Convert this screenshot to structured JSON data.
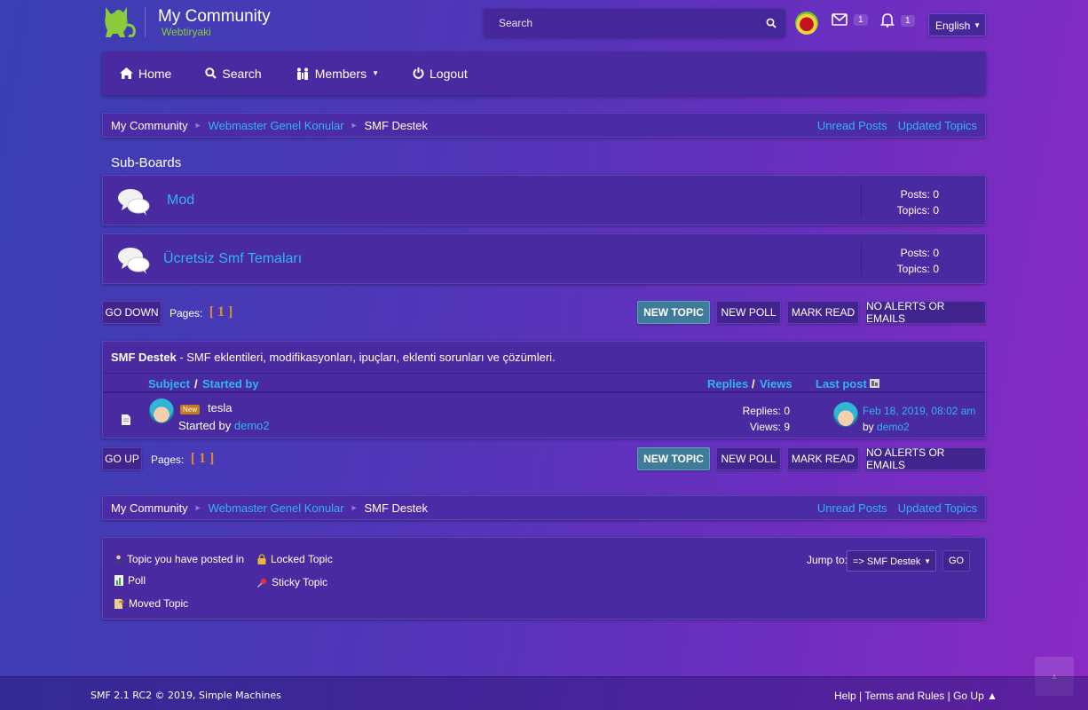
{
  "site": {
    "title": "My Community",
    "subtitle": "Webtiryaki"
  },
  "search": {
    "placeholder": "Search"
  },
  "user": {
    "messages_count": "1",
    "alerts_count": "1",
    "language": "English"
  },
  "nav": {
    "home": "Home",
    "search": "Search",
    "members": "Members",
    "logout": "Logout"
  },
  "breadcrumb": {
    "items": [
      "My Community",
      "Webmaster Genel Konular",
      "SMF Destek"
    ],
    "unread": "Unread Posts",
    "updated": "Updated Topics"
  },
  "subboards": {
    "title": "Sub-Boards",
    "boards": [
      {
        "name": "Mod",
        "posts": "Posts: 0",
        "topics": "Topics: 0"
      },
      {
        "name": "Ücretsiz Smf Temaları",
        "posts": "Posts: 0",
        "topics": "Topics: 0"
      }
    ]
  },
  "actions": {
    "go_down": "GO DOWN",
    "go_up": "GO UP",
    "pages_label": "Pages:",
    "page_num": "[ 1 ]",
    "new_topic": "NEW TOPIC",
    "new_poll": "NEW POLL",
    "mark_read": "MARK READ",
    "no_alerts": "NO ALERTS OR EMAILS"
  },
  "board": {
    "name": "SMF Destek",
    "description": " - SMF eklentileri, modifikasyonları, ipuçları, eklenti sorunları ve çözümleri."
  },
  "columns": {
    "subject": "Subject",
    "slash": "/",
    "started_by": "Started by",
    "replies": "Replies",
    "views": "Views",
    "last_post": "Last post"
  },
  "topics": [
    {
      "badge": "New",
      "title": "tesla",
      "started_prefix": "Started by ",
      "author": "demo2",
      "replies": "Replies: 0",
      "views": "Views: 9",
      "last_date": "Feb 18, 2019, 08:02 am",
      "last_by_prefix": "by ",
      "last_by": "demo2"
    }
  ],
  "legend": {
    "posted_in": "Topic you have posted in",
    "poll": "Poll",
    "moved": "Moved Topic",
    "locked": "Locked Topic",
    "sticky": "Sticky Topic"
  },
  "jump": {
    "label": "Jump to:",
    "selected": "=> SMF Destek",
    "go": "GO"
  },
  "footer": {
    "copyright": "SMF 2.1 RC2 © 2019, Simple Machines",
    "help": "Help",
    "terms": "Terms and Rules",
    "go_up": "Go Up ▲"
  },
  "colors": {
    "link": "#2fb6f0",
    "accent_button": "#3f7c9a",
    "page_number": "#e08a2e",
    "badge": "#c47b1c"
  }
}
